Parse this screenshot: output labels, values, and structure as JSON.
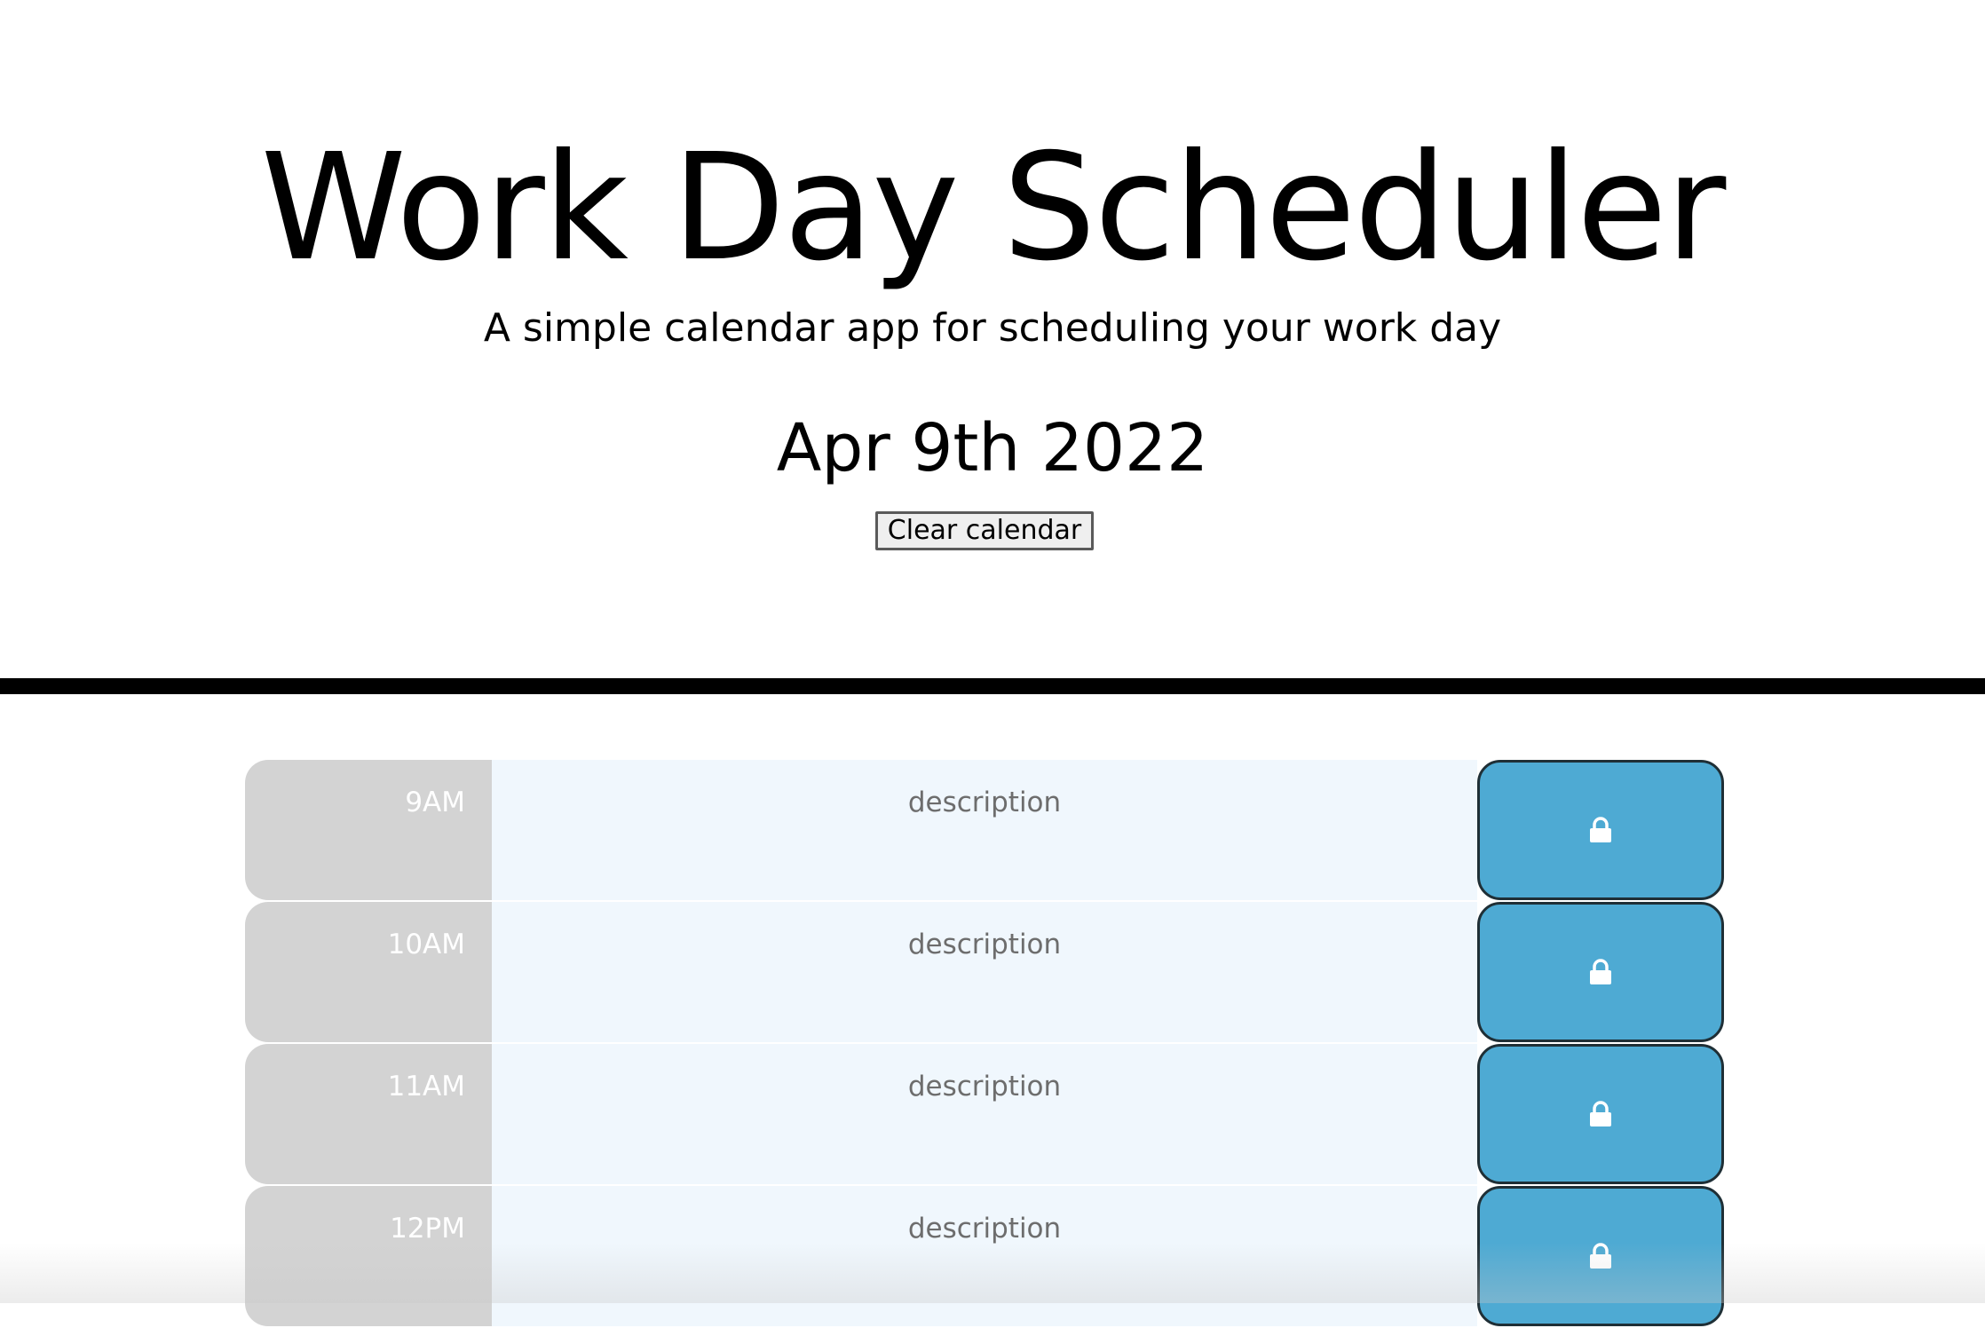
{
  "header": {
    "title": "Work Day Scheduler",
    "subtitle": "A simple calendar app for scheduling your work day",
    "current_day": "Apr 9th 2022",
    "clear_button_label": "Clear calendar"
  },
  "timeblocks": [
    {
      "hour": "9AM",
      "placeholder": "description",
      "save_icon": "lock-icon"
    },
    {
      "hour": "10AM",
      "placeholder": "description",
      "save_icon": "lock-icon"
    },
    {
      "hour": "11AM",
      "placeholder": "description",
      "save_icon": "lock-icon"
    },
    {
      "hour": "12PM",
      "placeholder": "description",
      "save_icon": "lock-icon"
    }
  ],
  "colors": {
    "hour_bg": "#d3d3d3",
    "description_bg": "#f0f7fd",
    "save_button_bg": "#4eaad3",
    "divider": "#000000"
  }
}
